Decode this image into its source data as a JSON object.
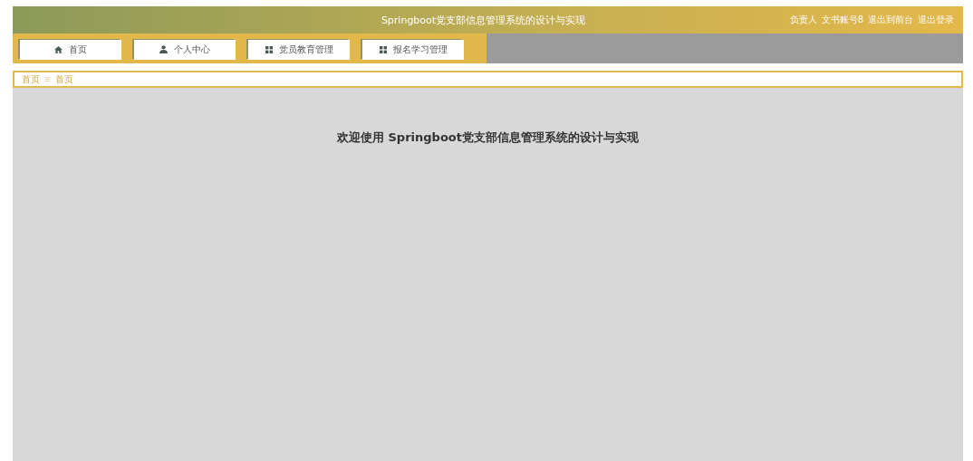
{
  "header": {
    "title": "Springboot党支部信息管理系统的设计与实现",
    "role": "负责人",
    "user": "文书账号8",
    "links": [
      "退出到前台",
      "退出登录"
    ]
  },
  "nav": [
    {
      "label": "首页",
      "kind": "home"
    },
    {
      "label": "个人中心",
      "kind": "user"
    },
    {
      "label": "党员教育管理",
      "kind": "module"
    },
    {
      "label": "报名学习管理",
      "kind": "module"
    }
  ],
  "breadcrumb": [
    "首页",
    "首页"
  ],
  "welcome": "欢迎使用 Springboot党支部信息管理系统的设计与实现"
}
